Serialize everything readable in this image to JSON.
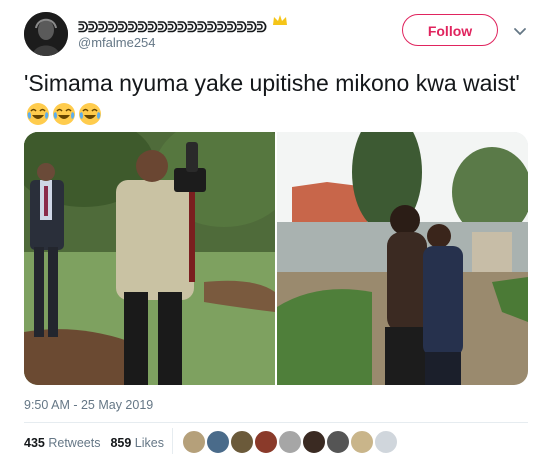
{
  "tweet": {
    "author_name": "ᕲᕲᕲᕲᕲᕲᕲᕲᕲᕲᕲᕲᕲᕲᕲᕲᕲᕲᕲ",
    "author_handle": "@mfalme254",
    "follow_label": "Follow",
    "text": "'Simama nyuma yake upitishe mikono kwa waist'",
    "emoji": [
      "face-with-tears-of-joy",
      "face-with-tears-of-joy",
      "face-with-tears-of-joy"
    ],
    "timestamp": "9:50 AM - 25 May 2019",
    "retweets_count": "435",
    "retweets_label": "Retweets",
    "likes_count": "859",
    "likes_label": "Likes",
    "likers": [
      "liker-1",
      "liker-2",
      "liker-3",
      "liker-4",
      "liker-5",
      "liker-6",
      "liker-7",
      "liker-8",
      "liker-9",
      "liker-10"
    ],
    "photos": [
      "photographer-in-garden-photo",
      "couple-embracing-photo"
    ]
  },
  "colors": {
    "follow_accent": "#e0245e",
    "secondary_text": "#657786",
    "primary_text": "#14171a",
    "divider": "#e6ecf0"
  }
}
